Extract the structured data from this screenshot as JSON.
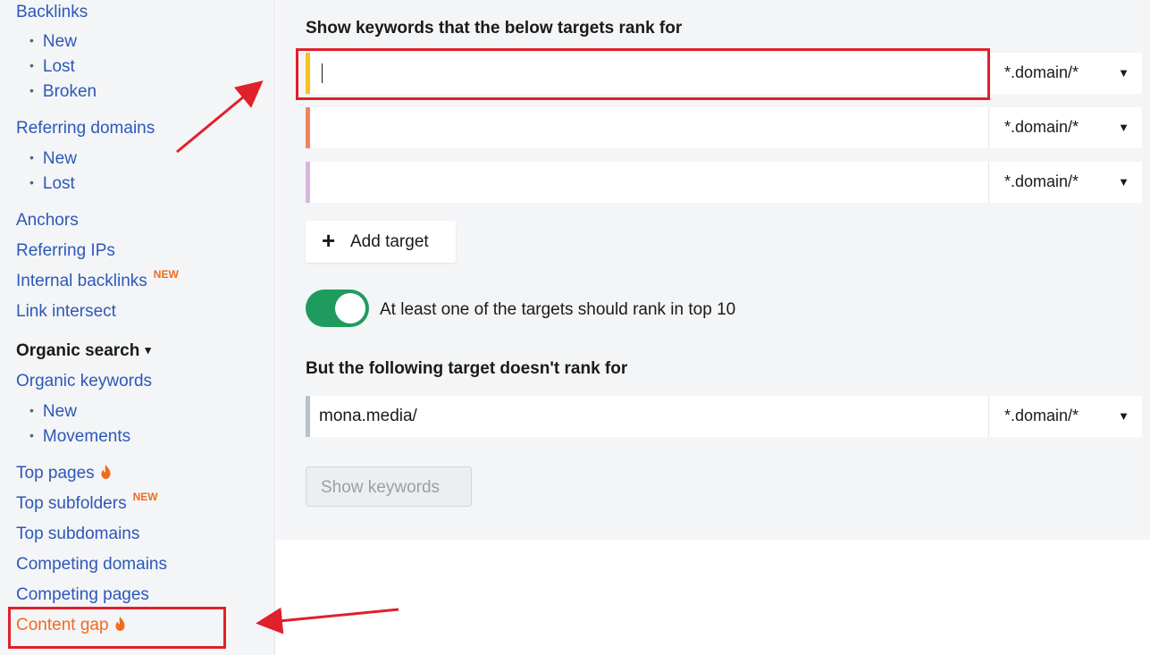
{
  "sidebar": {
    "backlinks": "Backlinks",
    "backlinks_sub": [
      "New",
      "Lost",
      "Broken"
    ],
    "referring_domains": "Referring domains",
    "referring_domains_sub": [
      "New",
      "Lost"
    ],
    "anchors": "Anchors",
    "referring_ips": "Referring IPs",
    "internal_backlinks": "Internal backlinks",
    "new_badge": "NEW",
    "link_intersect": "Link intersect",
    "organic_search": "Organic search",
    "organic_keywords": "Organic keywords",
    "organic_keywords_sub": [
      "New",
      "Movements"
    ],
    "top_pages": "Top pages",
    "top_subfolders": "Top subfolders",
    "top_subdomains": "Top subdomains",
    "competing_domains": "Competing domains",
    "competing_pages": "Competing pages",
    "content_gap": "Content gap",
    "bullet": "•",
    "caret": "▾"
  },
  "main": {
    "heading": "Show keywords that the below targets rank for",
    "targets": [
      {
        "value": "",
        "mode": "*.domain/*",
        "color": "#f6c21c"
      },
      {
        "value": "",
        "mode": "*.domain/*",
        "color": "#f0845c"
      },
      {
        "value": "",
        "mode": "*.domain/*",
        "color": "#d8b6dc"
      }
    ],
    "dropdown_arrow": "▼",
    "add_target_plus": "+",
    "add_target_label": "Add target",
    "toggle_on": true,
    "toggle_label": "At least one of the targets should rank in top 10",
    "exclude_heading": "But the following target doesn't rank for",
    "exclude_target": {
      "value": "mona.media/",
      "mode": "*.domain/*",
      "color": "#b8c2c8"
    },
    "show_keywords_label": "Show keywords"
  },
  "colors": {
    "link": "#2c58b8",
    "accent_orange": "#f26b1d",
    "toggle_green": "#1f9b5e",
    "annotation_red": "#e0202a"
  }
}
